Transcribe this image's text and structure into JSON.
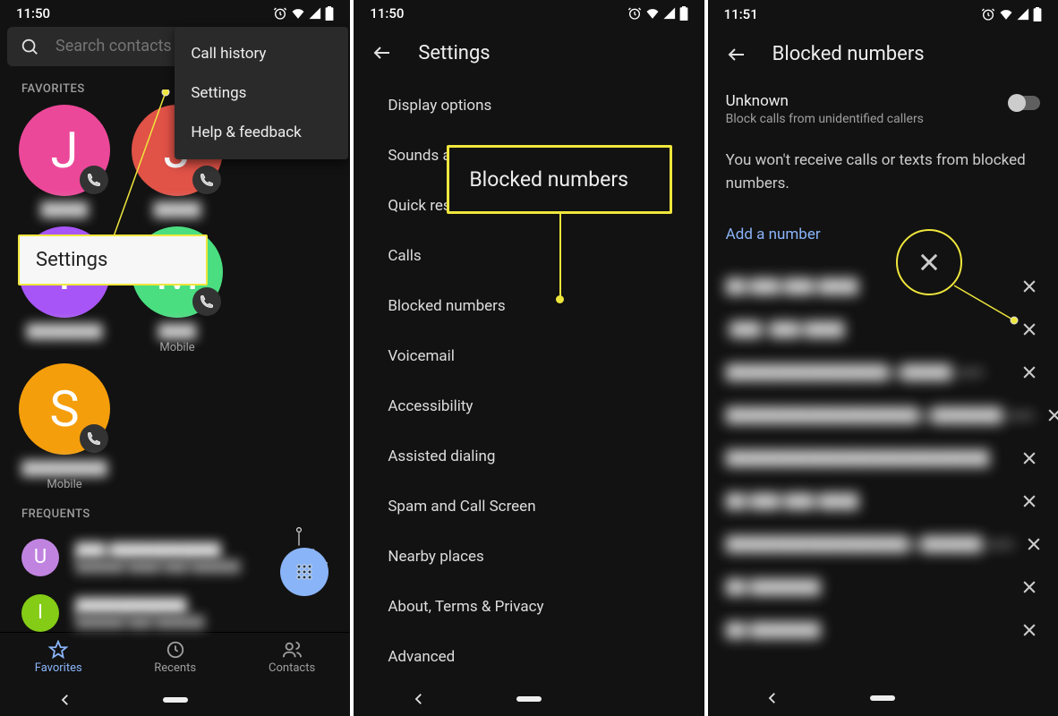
{
  "phone1": {
    "status": {
      "time": "11:50"
    },
    "search": {
      "placeholder": "Search contacts"
    },
    "menu": {
      "items": [
        "Call history",
        "Settings",
        "Help & feedback"
      ]
    },
    "callout": {
      "settings_label": "Settings"
    },
    "sections": {
      "favorites": "FAVORITES",
      "frequents": "FREQUENTS"
    },
    "favorites": [
      {
        "letter": "J",
        "color": "#ec4899",
        "name": "█████",
        "sub": ""
      },
      {
        "letter": "J",
        "color": "#e15247",
        "name": "█████",
        "sub": ""
      },
      {
        "letter": "Y",
        "color": "#a855f7",
        "name": "████████",
        "sub": ""
      },
      {
        "letter": "M",
        "color": "#4ade80",
        "name": "████",
        "sub": "Mobile"
      },
      {
        "letter": "S",
        "color": "#f59e0b",
        "name": "█████████",
        "sub": "Mobile"
      }
    ],
    "frequents": [
      {
        "letter": "U",
        "color": "#c084e0",
        "name": "███ ███████████",
        "sub": "██████ ████ ███ ██████"
      },
      {
        "letter": "I",
        "color": "#84cc16",
        "name": "███████████",
        "sub": "██████ ███ ██████"
      }
    ],
    "nav": {
      "favorites": "Favorites",
      "recents": "Recents",
      "contacts": "Contacts"
    }
  },
  "phone2": {
    "status": {
      "time": "11:50"
    },
    "header": {
      "title": "Settings"
    },
    "items": [
      "Display options",
      "Sounds and vibration",
      "Quick responses",
      "Calls",
      "Blocked numbers",
      "Voicemail",
      "Accessibility",
      "Assisted dialing",
      "Spam and Call Screen",
      "Nearby places",
      "About, Terms & Privacy",
      "Advanced"
    ],
    "callout": {
      "blocked_label": "Blocked numbers"
    }
  },
  "phone3": {
    "status": {
      "time": "11:51"
    },
    "header": {
      "title": "Blocked numbers"
    },
    "unknown": {
      "title": "Unknown",
      "sub": "Block calls from unidentified callers",
      "on": false
    },
    "info": "You won't receive calls or texts from blocked numbers.",
    "add": "Add a number",
    "blocked": [
      "██ ███ ███-████",
      "(███) ███-████",
      "████████████████@█████.com",
      "███████████████████@███████.com",
      "██████████████████████████",
      "██ ███-███-████",
      "██████████████████@██████.com",
      "██ ███████",
      "██ ███████"
    ]
  }
}
